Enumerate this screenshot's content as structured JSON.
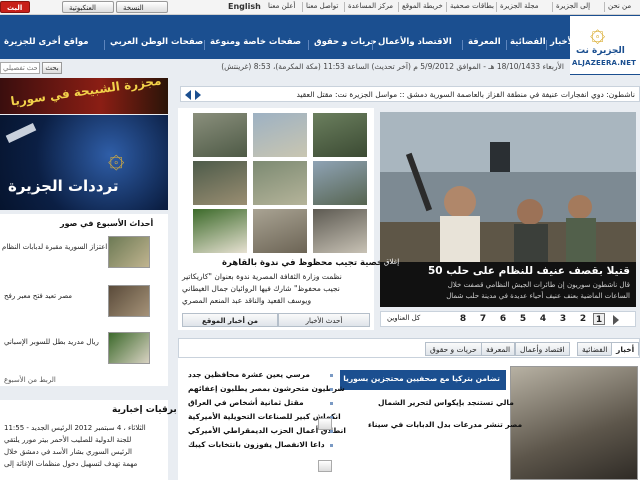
{
  "top_bar": {
    "links": [
      "من نحن",
      "إلى الجزيرة",
      "مجلة الجزيرة",
      "بطاقات صحفية",
      "خريطة الموقع",
      "مركز المساعدة",
      "تواصل معنا",
      "أعلن معنا"
    ],
    "language": "English",
    "btn_lite": "النسخة الخفيفة",
    "btn_classic": "العنكبوتية",
    "btn_live": "البث المباشر"
  },
  "logo": {
    "ar": "الجزيرة نت",
    "en": "ALJAZEERA.NET"
  },
  "nav": {
    "items": [
      "الأخبار",
      "الفضائية",
      "المعرفة",
      "الاقتصاد والأعمال",
      "حريات و حقوق",
      "صفحات خاصة ومنوعة",
      "صفحات الوطن العربي",
      "مواقع أخرى للجزيرة"
    ]
  },
  "datebar": {
    "text": "الأربعاء 18/10/1433 هـ - الموافق 5/9/2012 م (آخر تحديث) الساعة 11:53 (مكة المكرمة)، 8:53 (غرينتش)",
    "search_placeholder": "بحث تفصيلي",
    "search_button": "بحث"
  },
  "ticker": {
    "text": "ناشطون: دوي انفجارات عنيفة في منطقة القزاز بالعاصمة السورية دمشق  ::  مواسل الجزيرة نت: مقتل العقيد"
  },
  "left_column": {
    "ad1_text": "مجزرة الشبيحة في سوريا",
    "ad2_text": "ترددات الجزيرة",
    "week_section_title": "أحداث الأسبوع في صور",
    "week_items": [
      "اعتزاز السورية مقبرة لدبابات النظام",
      "مصر تعيد فتح معبر رفح",
      "ريال مدريد بطل للسوبر الإسباني"
    ],
    "brief_section_title": "برقيات إخبارية",
    "brief_text_lines": [
      "11:55 - الثلاثاء ، 4 سبتمبر 2012 الرئيس الجديد",
      "للجنة الدولية للصليب الأحمر بيتر مورر يلتقي",
      "الرئيس السوري بشار الأسد في دمشق خلال",
      "مهمة تهدف لتسهيل دخول منظمات الإغاثة إلى"
    ],
    "also_label": "الرئيس في الأسبوع",
    "more_link": "الربط من الأسبوع"
  },
  "middle_column": {
    "story_title": "شخصية تجيب محظوظ في ندوة بالقاهرة",
    "story_lines": [
      "نظمت وزارة الثقافة المصرية ندوة بعنوان \"كاريكاتير",
      "نجيب محفوظ\" شارك فيها الروائيان جمال الغيطاني",
      "ويوسف القعيد والناقد عبد المنعم المصري"
    ],
    "tab_latest": "أحدث الأخبار",
    "tab_most_read": "من أخبار الموقع"
  },
  "main_story": {
    "title": "50 قتيلا بقصف عنيف للنظام على حلب",
    "lines": [
      "قال ناشطون سوريون إن طائرات الجيش النظامي قصفت خلال",
      "الساعات الماضية بعنف عنيف أحياء عديدة في مدينة حلب شمال"
    ],
    "close_label": "إغلاق",
    "pages": [
      "1",
      "2",
      "3",
      "4",
      "5",
      "6",
      "7",
      "8"
    ],
    "active_page": "1",
    "all_headlines": "كل العناوين"
  },
  "bottom_tabs": {
    "tabs": [
      "أخبار",
      "الفضائية",
      "اقتصاد وأعمال",
      "المعرفة",
      "حريات و حقوق"
    ],
    "active": "أخبار"
  },
  "bottom_news": {
    "headlines_col": [
      "تضامن بتركيا مع صحفيين محتجزين بسوريا",
      "مالي تستنجد بإيكواس لتحرير الشمال",
      "مصر تنشر مدرعات بدل الدبابات في سيناء"
    ],
    "list_col": [
      "مرسي يعين عشرة محافظين جدد",
      "شرطيون متحرشون بمصر يطلبون إعفائهم",
      "مقتل ثمانية أشخاص في العراق",
      "انكماش كبير للصناعات التحويلية الأميركية",
      "انطلاق أعمال الحزب الديمقراطي الأميركي",
      "داعا الانفصال يفوزون بانتخابات كيبك"
    ]
  },
  "colors": {
    "header_blue": "#1b4f90",
    "gold": "#d6a41a",
    "red": "#c8201a"
  }
}
